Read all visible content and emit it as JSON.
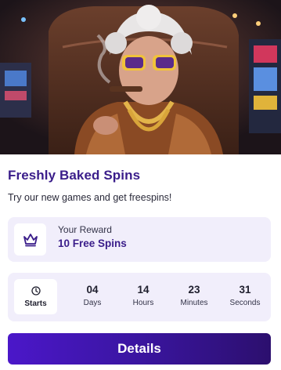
{
  "card": {
    "title": "Freshly Baked Spins",
    "subtitle": "Try our new games and get freespins!"
  },
  "reward": {
    "label": "Your Reward",
    "value": "10 Free Spins",
    "icon": "crown-icon"
  },
  "countdown": {
    "starts_label": "Starts",
    "starts_icon": "clock-icon",
    "units": [
      {
        "value": "04",
        "label": "Days"
      },
      {
        "value": "14",
        "label": "Hours"
      },
      {
        "value": "23",
        "label": "Minutes"
      },
      {
        "value": "31",
        "label": "Seconds"
      }
    ]
  },
  "button": {
    "label": "Details"
  },
  "colors": {
    "accent": "#3a1d8a",
    "panel": "#f1eefb",
    "button_start": "#4b17c9",
    "button_end": "#2c0f6e"
  }
}
